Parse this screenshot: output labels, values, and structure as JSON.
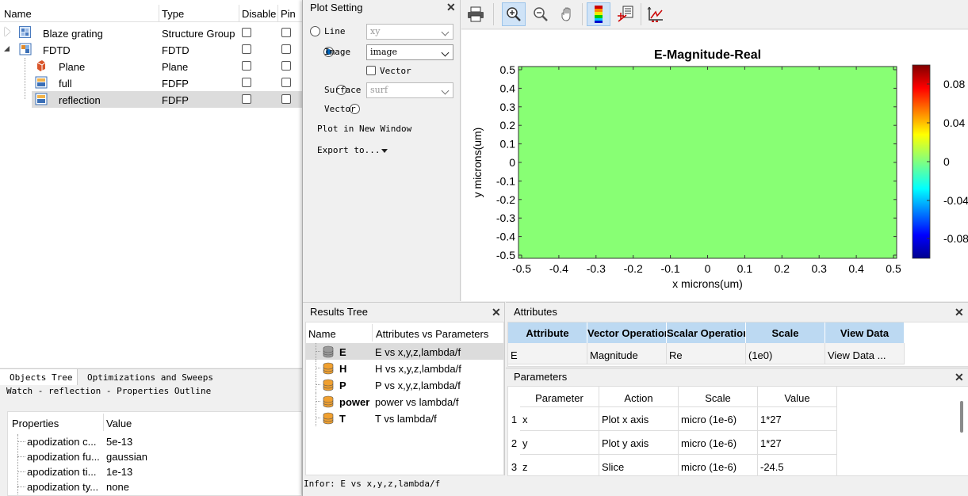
{
  "objects_tree": {
    "columns": [
      "Name",
      "Type",
      "Disable",
      "Pin"
    ],
    "rows": [
      {
        "name": "Blaze grating",
        "type": "Structure Group",
        "icon": "structure-group-icon"
      },
      {
        "name": "FDTD",
        "type": "FDTD",
        "icon": "fdtd-icon"
      },
      {
        "name": "Plane",
        "type": "Plane",
        "icon": "plane-source-icon"
      },
      {
        "name": "full",
        "type": "FDFP",
        "icon": "monitor-icon"
      },
      {
        "name": "reflection",
        "type": "FDFP",
        "icon": "monitor-icon"
      }
    ],
    "tabs": [
      "Objects Tree",
      "Optimizations and Sweeps"
    ],
    "watch_title": "Watch - reflection - Properties Outline",
    "props_columns": [
      "Properties",
      "Value"
    ],
    "props": [
      {
        "name": "apodization c...",
        "value": "5e-13"
      },
      {
        "name": "apodization fu...",
        "value": "gaussian"
      },
      {
        "name": "apodization ti...",
        "value": "1e-13"
      },
      {
        "name": "apodization ty...",
        "value": "none"
      }
    ]
  },
  "plot_setting": {
    "title": "Plot Setting",
    "line_label": "Line",
    "line_value": "xy",
    "image_label": "Image",
    "image_value": "image",
    "vector_check_label": "Vector",
    "surface_label": "Surface",
    "surface_value": "surf",
    "vector_label": "Vector",
    "new_window": "Plot in New Window",
    "export": "Export to..."
  },
  "plot": {
    "title": "E-Magnitude-Real",
    "xlabel": "x microns(um)",
    "ylabel": "y microns(um)",
    "xticks": [
      "-0.5",
      "-0.4",
      "-0.3",
      "-0.2",
      "-0.1",
      "0",
      "0.1",
      "0.2",
      "0.3",
      "0.4",
      "0.5"
    ],
    "yticks": [
      "0.5",
      "0.4",
      "0.3",
      "0.2",
      "0.1",
      "0",
      "-0.1",
      "-0.2",
      "-0.3",
      "-0.4",
      "-0.5"
    ],
    "cbar_ticks": [
      "0.08",
      "0.04",
      "0",
      "-0.04",
      "-0.08"
    ],
    "fill_color": "#88ff74"
  },
  "results_tree": {
    "title": "Results Tree",
    "columns": [
      "Name",
      "Attributes vs Parameters"
    ],
    "rows": [
      {
        "name": "E",
        "attr": "E vs x,y,z,lambda/f"
      },
      {
        "name": "H",
        "attr": "H vs x,y,z,lambda/f"
      },
      {
        "name": "P",
        "attr": "P vs x,y,z,lambda/f"
      },
      {
        "name": "power",
        "attr": "power vs lambda/f"
      },
      {
        "name": "T",
        "attr": "T vs lambda/f"
      }
    ]
  },
  "attributes": {
    "title": "Attributes",
    "columns": [
      "Attribute",
      "Vector Operation",
      "Scalar Operation",
      "Scale",
      "View Data"
    ],
    "row": [
      "E",
      "Magnitude",
      "Re",
      "(1e0)",
      "View Data ..."
    ]
  },
  "parameters": {
    "title": "Parameters",
    "columns": [
      "Parameter",
      "Action",
      "Scale",
      "Value"
    ],
    "rows": [
      {
        "idx": "1",
        "param": "x",
        "action": "Plot x axis",
        "scale": "micro (1e-6)",
        "value": "1*27"
      },
      {
        "idx": "2",
        "param": "y",
        "action": "Plot y axis",
        "scale": "micro (1e-6)",
        "value": "1*27"
      },
      {
        "idx": "3",
        "param": "z",
        "action": "Slice",
        "scale": "micro (1e-6)",
        "value": "-24.5"
      }
    ]
  },
  "status": "Infor: E vs x,y,z,lambda/f"
}
